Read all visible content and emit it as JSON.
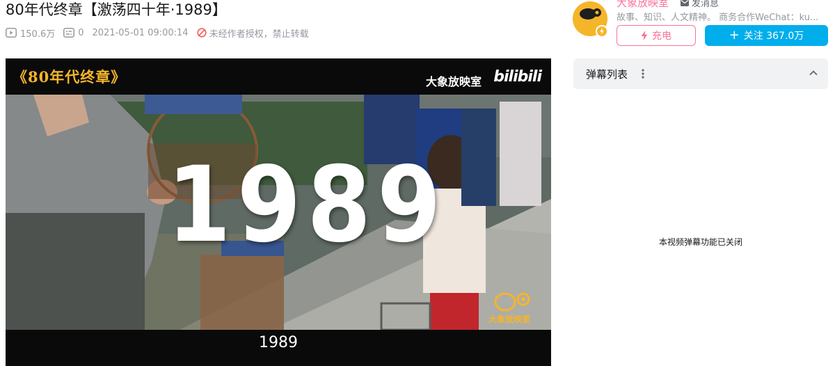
{
  "video": {
    "title": "80年代终章【激荡四十年·1989】",
    "views": "150.6万",
    "danmaku_count": "0",
    "publish_time": "2021-05-01 09:00:14",
    "copyright_notice": "未经作者授权，禁止转载"
  },
  "player": {
    "series_title": "《80年代终章》",
    "channel_watermark": "大象放映室",
    "platform_logo": "bilibili",
    "big_year": "1989",
    "corner_logo_text": "大象放映室",
    "subtitle": "1989"
  },
  "uploader": {
    "name": "大象放映室",
    "message_label": "发消息",
    "description": "故事、知识、人文精神。 商务合作WeChat：ku...",
    "charge_label": "充电",
    "follow_label": "关注 367.0万",
    "avatar_text": "大象放映室"
  },
  "danmaku": {
    "list_title": "弹幕列表",
    "closed_notice": "本视频弹幕功能已关闭"
  },
  "colors": {
    "pink": "#fb7299",
    "blue": "#00aeec",
    "gray_text": "#9499a0",
    "warning_red": "#f25d59",
    "series_title_gold": "#f5b52a"
  },
  "icons": [
    "play-count-icon",
    "danmaku-count-icon",
    "no-reprint-icon",
    "message-icon",
    "charge-icon",
    "more-icon",
    "chevron-up-icon",
    "verified-badge-icon"
  ]
}
